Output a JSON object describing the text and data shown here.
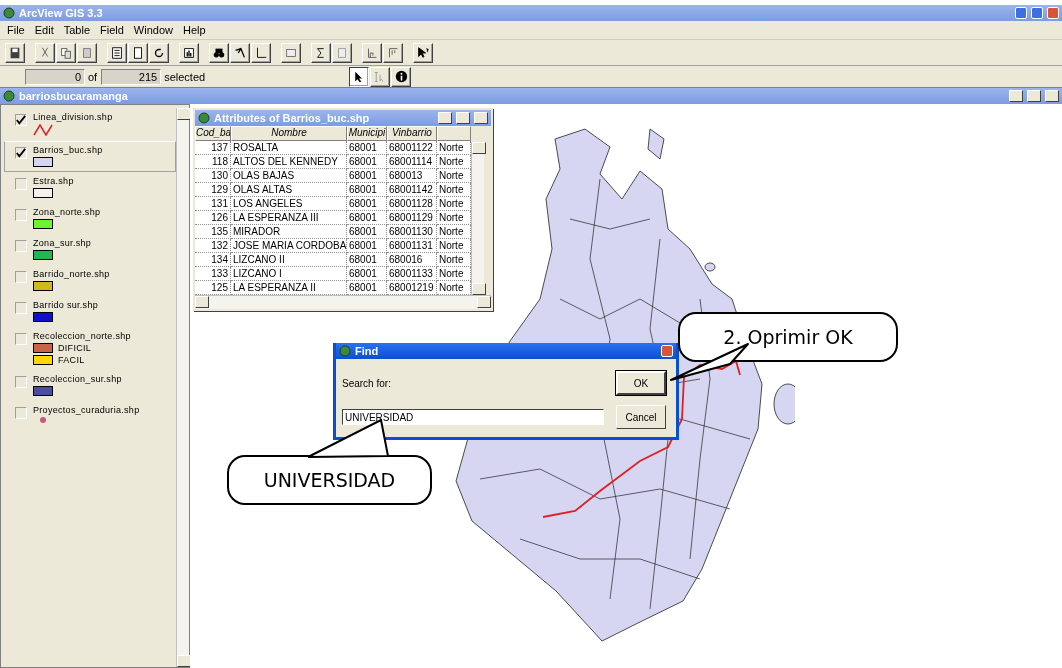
{
  "app": {
    "title": "ArcView GIS 3.3"
  },
  "menu": [
    {
      "label": "File"
    },
    {
      "label": "Edit"
    },
    {
      "label": "Table"
    },
    {
      "label": "Field"
    },
    {
      "label": "Window"
    },
    {
      "label": "Help"
    }
  ],
  "selection": {
    "count": "0",
    "of": "of",
    "total": "215",
    "suffix": "selected"
  },
  "tools": [
    {
      "kind": "pointer",
      "selected": true
    },
    {
      "kind": "text-select",
      "selected": false
    },
    {
      "kind": "identify",
      "selected": false
    }
  ],
  "view": {
    "title": "barriosbucaramanga"
  },
  "legend": [
    {
      "name": "Linea_division.shp",
      "kind": "line",
      "checked": true,
      "selected": false,
      "color": "#e02828"
    },
    {
      "name": "Barrios_buc.shp",
      "kind": "fill",
      "checked": true,
      "selected": true,
      "color": "#d4d4f4"
    },
    {
      "name": "Estra.shp",
      "kind": "fill",
      "checked": false,
      "selected": false,
      "color": "#f4f2ea"
    },
    {
      "name": "Zona_norte.shp",
      "kind": "fill",
      "checked": false,
      "selected": false,
      "color": "#6cf42c"
    },
    {
      "name": "Zona_sur.shp",
      "kind": "fill",
      "checked": false,
      "selected": false,
      "color": "#20b850"
    },
    {
      "name": "Barrido_norte.shp",
      "kind": "fill",
      "checked": false,
      "selected": false,
      "color": "#d4b818"
    },
    {
      "name": "Barrido sur.shp",
      "kind": "fill",
      "checked": false,
      "selected": false,
      "color": "#1010d0"
    },
    {
      "name": "Recoleccion_norte.shp",
      "kind": "classes",
      "checked": false,
      "selected": false,
      "classes": [
        {
          "label": "DIFICIL",
          "color": "#c86448"
        },
        {
          "label": "FACIL",
          "color": "#fcd800"
        }
      ]
    },
    {
      "name": "Recoleccion_sur.shp",
      "kind": "fill",
      "checked": false,
      "selected": false,
      "color": "#4c4ca0"
    },
    {
      "name": "Proyectos_curaduria.shp",
      "kind": "point",
      "checked": false,
      "selected": false,
      "color": "#c85a7c"
    }
  ],
  "attributes": {
    "title": "Attributes of Barrios_buc.shp",
    "columns": [
      "Cod_ba",
      "Nombre",
      "Municipi",
      "Vinbarrio"
    ],
    "rows": [
      [
        "137",
        "ROSALTA",
        "68001",
        "68001122",
        "Norte"
      ],
      [
        "118",
        "ALTOS DEL KENNEDY",
        "68001",
        "68001114",
        "Norte"
      ],
      [
        "130",
        "OLAS BAJAS",
        "68001",
        "680013",
        "Norte"
      ],
      [
        "129",
        "OLAS ALTAS",
        "68001",
        "68001142",
        "Norte"
      ],
      [
        "131",
        "LOS ANGELES",
        "68001",
        "68001128",
        "Norte"
      ],
      [
        "126",
        "LA ESPERANZA III",
        "68001",
        "68001129",
        "Norte"
      ],
      [
        "135",
        "MIRADOR",
        "68001",
        "68001130",
        "Norte"
      ],
      [
        "132",
        "JOSE MARIA CORDOBA",
        "68001",
        "68001131",
        "Norte"
      ],
      [
        "134",
        "LIZCANO II",
        "68001",
        "680016",
        "Norte"
      ],
      [
        "133",
        "LIZCANO I",
        "68001",
        "68001133",
        "Norte"
      ],
      [
        "125",
        "LA ESPERANZA II",
        "68001",
        "68001219",
        "Norte"
      ]
    ]
  },
  "find": {
    "title": "Find",
    "label": "Search for:",
    "value": "UNIVERSIDAD",
    "buttons": [
      {
        "label": "OK",
        "default": true
      },
      {
        "label": "Cancel",
        "default": false
      }
    ]
  },
  "callouts": [
    {
      "text": "2. Oprimir OK",
      "kind": "ok"
    },
    {
      "text": "UNIVERSIDAD",
      "kind": "field"
    }
  ]
}
